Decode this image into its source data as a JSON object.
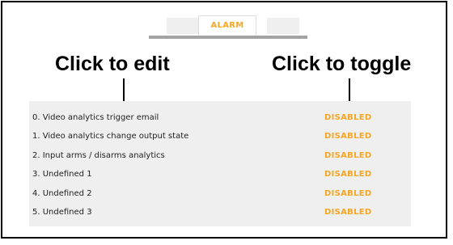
{
  "tabs": {
    "active_label": "ALARM"
  },
  "callouts": {
    "edit": "Click to edit",
    "toggle": "Click to toggle"
  },
  "alarms": [
    {
      "label": "0. Video analytics trigger email",
      "state": "DISABLED"
    },
    {
      "label": "1. Video analytics change output state",
      "state": "DISABLED"
    },
    {
      "label": "2. Input arms / disarms analytics",
      "state": "DISABLED"
    },
    {
      "label": "3. Undefined 1",
      "state": "DISABLED"
    },
    {
      "label": "4. Undefined 2",
      "state": "DISABLED"
    },
    {
      "label": "5. Undefined 3",
      "state": "DISABLED"
    }
  ],
  "colors": {
    "accent": "#f5a623",
    "panel": "#efefef",
    "tab_underline": "#a3a3a3"
  }
}
